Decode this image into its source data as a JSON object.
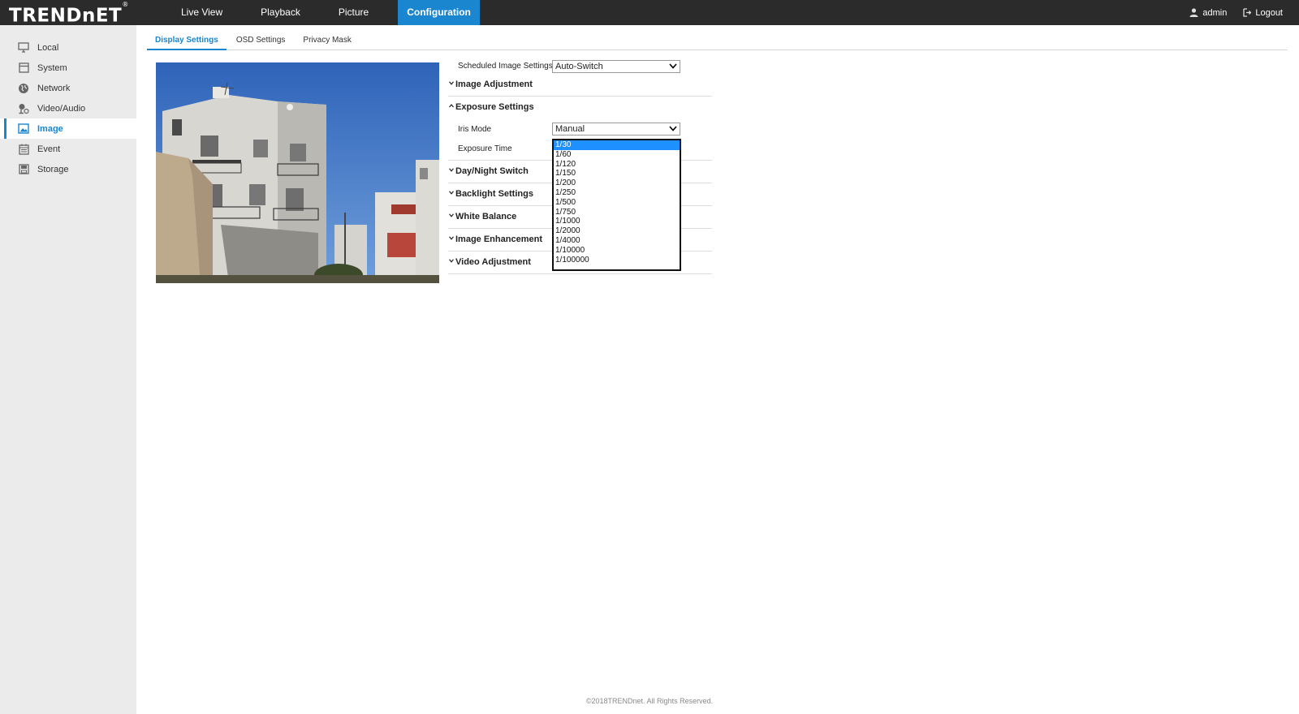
{
  "header": {
    "logo": "TRENDnET",
    "logo_mark": "®",
    "nav": [
      {
        "label": "Live View"
      },
      {
        "label": "Playback"
      },
      {
        "label": "Picture"
      },
      {
        "label": "Configuration"
      }
    ],
    "user": "admin",
    "logout": "Logout"
  },
  "sidebar": {
    "items": [
      {
        "label": "Local",
        "icon": "monitor-icon"
      },
      {
        "label": "System",
        "icon": "system-icon"
      },
      {
        "label": "Network",
        "icon": "globe-icon"
      },
      {
        "label": "Video/Audio",
        "icon": "microphone-icon"
      },
      {
        "label": "Image",
        "icon": "image-icon"
      },
      {
        "label": "Event",
        "icon": "calendar-icon"
      },
      {
        "label": "Storage",
        "icon": "storage-icon"
      }
    ]
  },
  "tabs": [
    {
      "label": "Display Settings"
    },
    {
      "label": "OSD Settings"
    },
    {
      "label": "Privacy Mask"
    }
  ],
  "settings": {
    "scheduled_label": "Scheduled Image Settings",
    "scheduled_value": "Auto-Switch",
    "image_adjustment": "Image Adjustment",
    "exposure_settings": "Exposure Settings",
    "iris_label": "Iris Mode",
    "iris_value": "Manual",
    "exposure_time_label": "Exposure Time",
    "day_night": "Day/Night Switch",
    "backlight": "Backlight Settings",
    "white_balance": "White Balance",
    "image_enhancement": "Image Enhancement",
    "video_adjustment": "Video Adjustment"
  },
  "exposure_options": [
    "1/30",
    "1/60",
    "1/120",
    "1/150",
    "1/200",
    "1/250",
    "1/500",
    "1/750",
    "1/1000",
    "1/2000",
    "1/4000",
    "1/10000",
    "1/100000"
  ],
  "footer": "©2018TRENDnet. All Rights Reserved.",
  "colors": {
    "accent": "#1a86d0",
    "topbar": "#2b2b2b",
    "sidebar": "#ebebeb",
    "selected_option": "#1e90ff"
  }
}
